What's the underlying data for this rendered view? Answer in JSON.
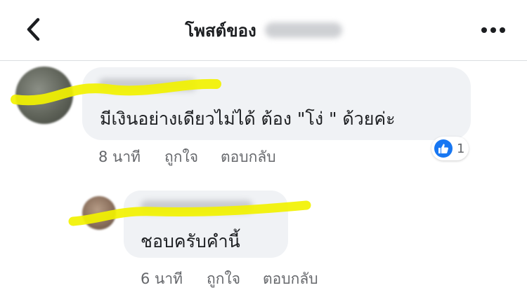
{
  "header": {
    "title": "โพสต์ของ",
    "back_icon": "chevron-left-icon",
    "more_icon": "more-horizontal-icon"
  },
  "comments": [
    {
      "text": "มีเงินอย่างเดียวไม่ได้ ต้อง \"โง่ \" ด้วยค่ะ",
      "time": "8 นาที",
      "like_label": "ถูกใจ",
      "reply_label": "ตอบกลับ",
      "reaction": {
        "icon": "like-icon",
        "count": "1",
        "color": "#1877f2"
      }
    },
    {
      "text": "ชอบครับคำนี้",
      "time": "6 นาที",
      "like_label": "ถูกใจ",
      "reply_label": "ตอบกลับ"
    }
  ],
  "colors": {
    "bubble": "#f0f2f5",
    "meta_text": "#65676b",
    "highlighter": "#f2f200"
  }
}
